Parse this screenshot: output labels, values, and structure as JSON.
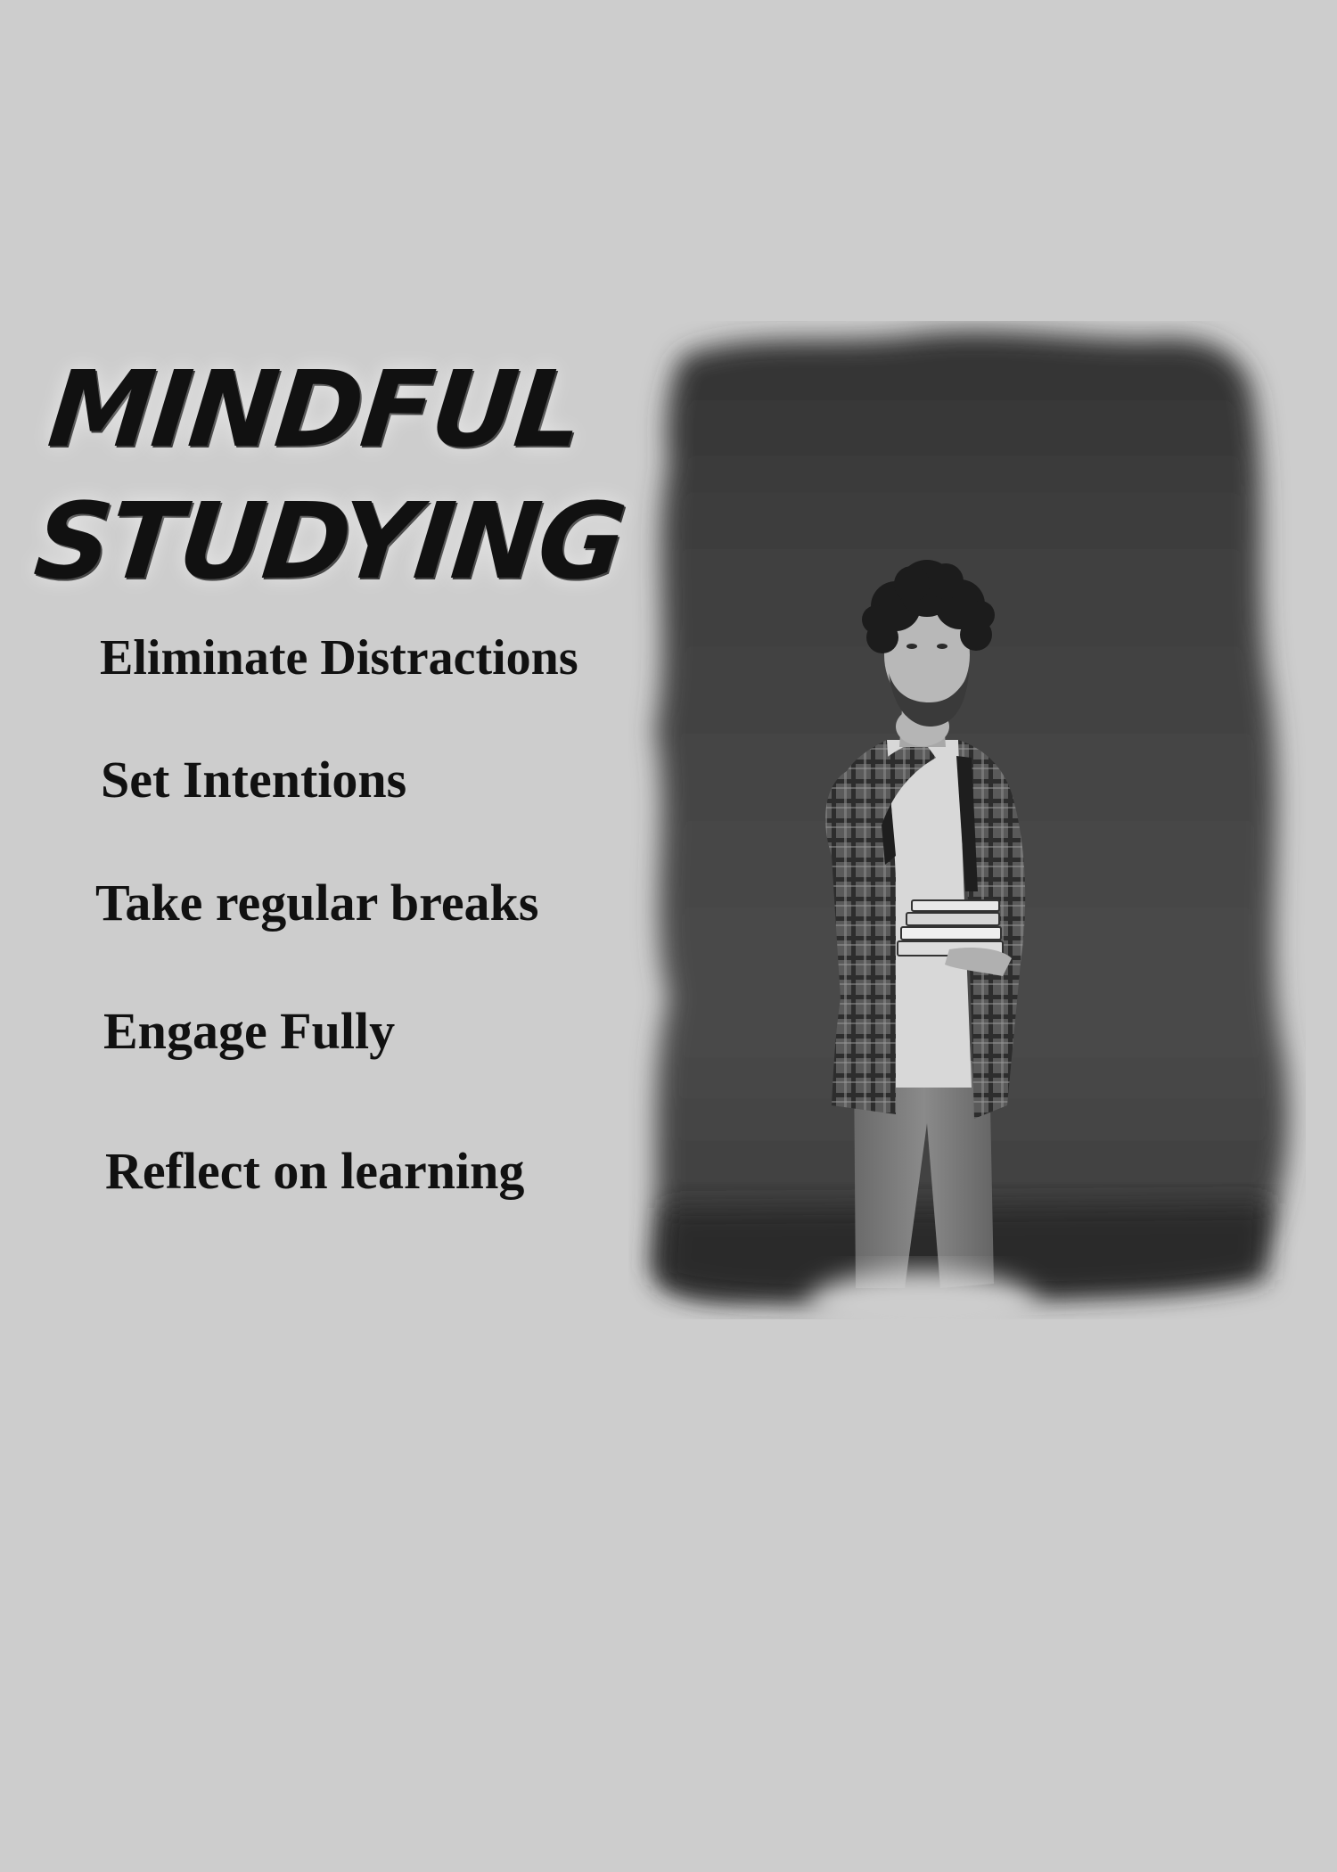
{
  "poster": {
    "title_line1": "MINDFUL",
    "title_line2": "STUDYING",
    "tips": [
      "Eliminate Distractions",
      "Set Intentions",
      "Take regular breaks",
      "Engage Fully",
      "Reflect on learning"
    ]
  },
  "photo": {
    "subject": "student-with-books"
  },
  "colors": {
    "background": "#cdcdcd",
    "text": "#111111",
    "photo_dark": "#3a3a3a"
  }
}
